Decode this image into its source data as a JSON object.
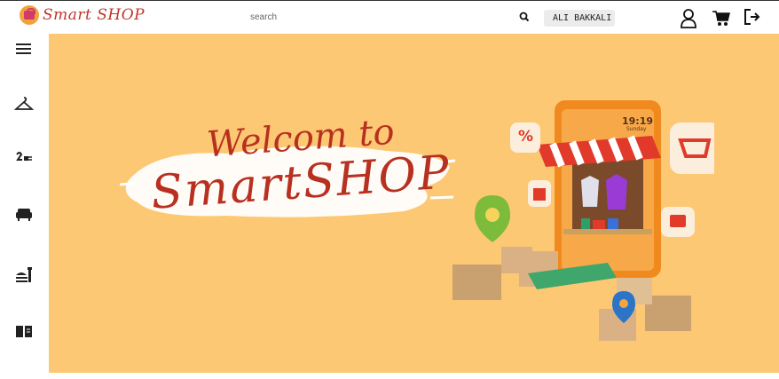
{
  "header": {
    "logo_text": "Smart SHOP",
    "search_placeholder": "search",
    "user_name": "ALI BAKKALI",
    "icons": [
      "search-icon",
      "user-icon",
      "cart-icon",
      "logout-icon"
    ]
  },
  "sidebar": {
    "items": [
      {
        "icon": "menu-icon"
      },
      {
        "icon": "hanger-icon"
      },
      {
        "icon": "appliance-icon"
      },
      {
        "icon": "sofa-icon"
      },
      {
        "icon": "food-icon"
      },
      {
        "icon": "book-icon"
      }
    ]
  },
  "hero": {
    "line1": "Welcom to",
    "line2": "SmartSHOP",
    "phone_time": "19:19",
    "phone_day": "Sunday",
    "percent_label": "%",
    "background": "#fdc873",
    "accent": "#b83020"
  }
}
